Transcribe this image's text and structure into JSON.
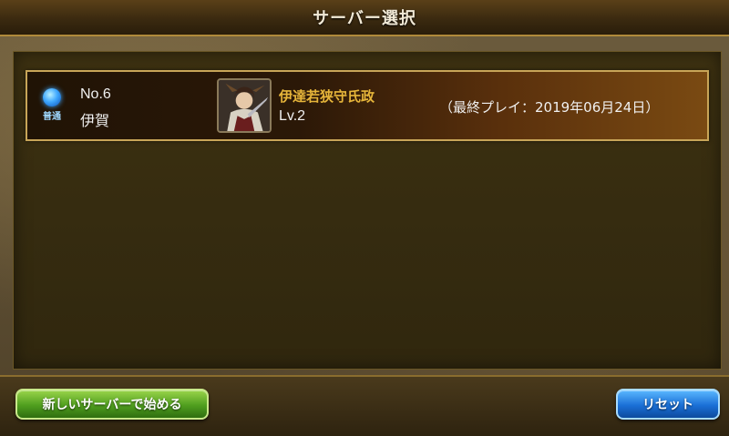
{
  "header": {
    "title": "サーバー選択"
  },
  "servers": [
    {
      "status_label": "普通",
      "number": "No.6",
      "name": "伊賀",
      "character_name": "伊達若狭守氏政",
      "level": "Lv.2",
      "last_play": "（最終プレイ：2019年06月24日）",
      "icons": {
        "status": "status-orb-icon",
        "avatar": "character-avatar-icon"
      }
    }
  ],
  "footer": {
    "new_server_label": "新しいサーバーで始める",
    "reset_label": "リセット"
  },
  "colors": {
    "accent_gold": "#c8a558",
    "character_name": "#e6b53a",
    "new_button": "#4f9e1e",
    "reset_button": "#1a6fd6",
    "status_orb": "#3fa8ff"
  }
}
